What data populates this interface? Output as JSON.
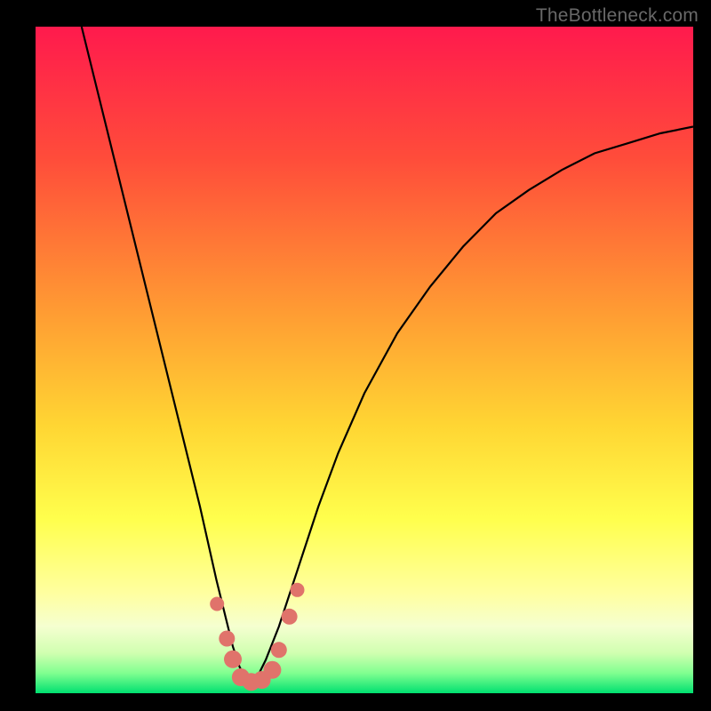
{
  "watermark": "TheBottleneck.com",
  "gradient_stops": [
    {
      "offset": 0,
      "color": "#ff1a4d"
    },
    {
      "offset": 0.2,
      "color": "#ff4d3a"
    },
    {
      "offset": 0.42,
      "color": "#ff9933"
    },
    {
      "offset": 0.6,
      "color": "#ffd633"
    },
    {
      "offset": 0.74,
      "color": "#ffff4d"
    },
    {
      "offset": 0.85,
      "color": "#ffffa0"
    },
    {
      "offset": 0.9,
      "color": "#f5ffd0"
    },
    {
      "offset": 0.94,
      "color": "#d0ffb0"
    },
    {
      "offset": 0.97,
      "color": "#80ff90"
    },
    {
      "offset": 1.0,
      "color": "#00e070"
    }
  ],
  "chart_data": {
    "type": "line",
    "title": "",
    "xlabel": "",
    "ylabel": "",
    "xlim": [
      0,
      1
    ],
    "ylim": [
      0,
      1
    ],
    "series": [
      {
        "name": "curve",
        "x": [
          0.07,
          0.1,
          0.13,
          0.16,
          0.19,
          0.22,
          0.25,
          0.275,
          0.29,
          0.3,
          0.31,
          0.32,
          0.325,
          0.33,
          0.34,
          0.35,
          0.37,
          0.39,
          0.41,
          0.43,
          0.46,
          0.5,
          0.55,
          0.6,
          0.65,
          0.7,
          0.75,
          0.8,
          0.85,
          0.9,
          0.95,
          1.0
        ],
        "y": [
          1.0,
          0.88,
          0.76,
          0.64,
          0.52,
          0.4,
          0.28,
          0.17,
          0.11,
          0.07,
          0.04,
          0.02,
          0.016,
          0.02,
          0.03,
          0.05,
          0.1,
          0.16,
          0.22,
          0.28,
          0.36,
          0.45,
          0.54,
          0.61,
          0.67,
          0.72,
          0.755,
          0.785,
          0.81,
          0.825,
          0.84,
          0.85
        ]
      }
    ],
    "markers": [
      {
        "x": 0.276,
        "y": 0.134,
        "r": 8
      },
      {
        "x": 0.291,
        "y": 0.082,
        "r": 9
      },
      {
        "x": 0.3,
        "y": 0.051,
        "r": 10
      },
      {
        "x": 0.312,
        "y": 0.024,
        "r": 10
      },
      {
        "x": 0.328,
        "y": 0.017,
        "r": 10
      },
      {
        "x": 0.344,
        "y": 0.02,
        "r": 10
      },
      {
        "x": 0.36,
        "y": 0.035,
        "r": 10
      },
      {
        "x": 0.37,
        "y": 0.065,
        "r": 9
      },
      {
        "x": 0.386,
        "y": 0.115,
        "r": 9
      },
      {
        "x": 0.398,
        "y": 0.155,
        "r": 8
      }
    ],
    "marker_color": "#e0736b"
  }
}
